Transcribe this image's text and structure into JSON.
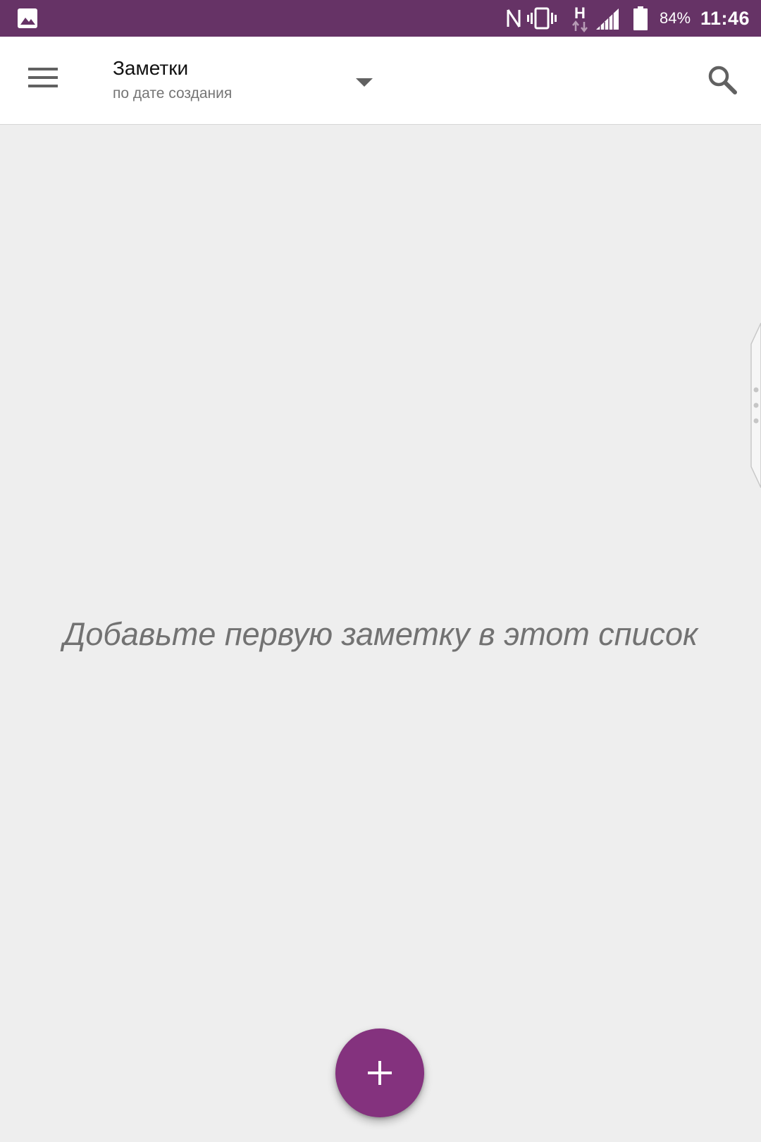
{
  "status_bar": {
    "battery_percent": "84%",
    "time": "11:46",
    "network_type": "H",
    "background_color": "#663366",
    "icons": [
      "gallery-icon",
      "nfc-icon",
      "vibrate-icon",
      "network-h-icon",
      "signal-icon",
      "battery-icon"
    ]
  },
  "toolbar": {
    "title": "Заметки",
    "subtitle": "по дате создания",
    "icons": [
      "menu-icon",
      "dropdown-arrow-icon",
      "search-icon"
    ]
  },
  "main": {
    "empty_message": "Добавьте первую заметку в этот список"
  },
  "fab": {
    "icon": "plus-icon",
    "color": "#84327e"
  }
}
